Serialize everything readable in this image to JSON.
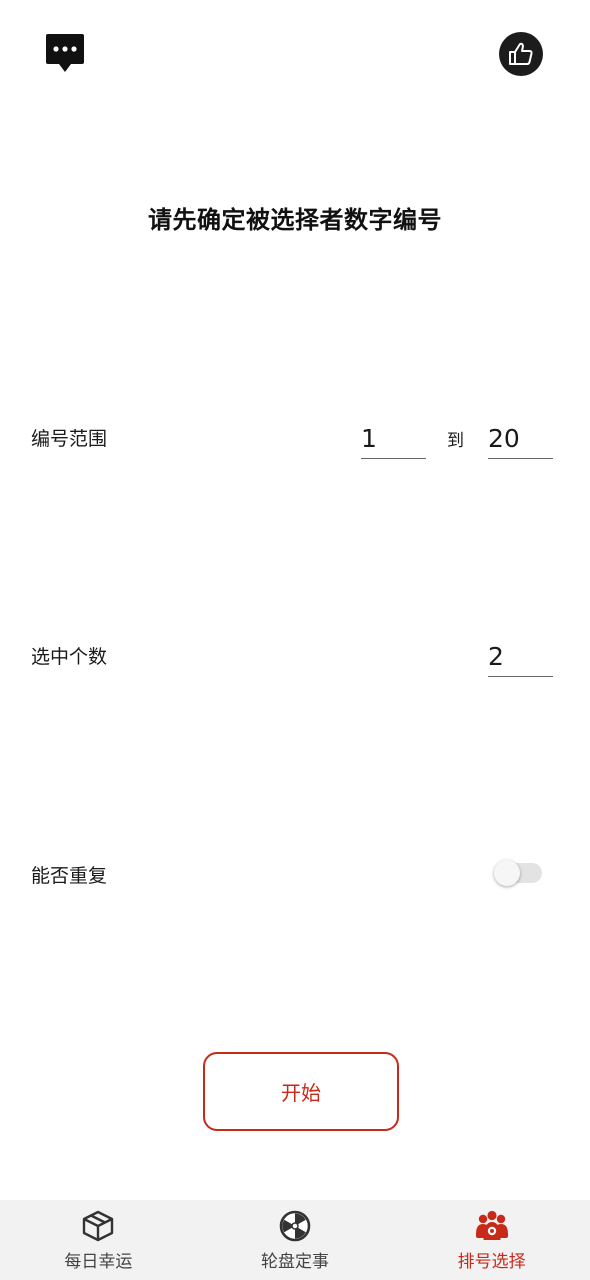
{
  "title": "请先确定被选择者数字编号",
  "range": {
    "label": "编号范围",
    "from_value": "1",
    "to_label": "到",
    "to_value": "20"
  },
  "count": {
    "label": "选中个数",
    "value": "2"
  },
  "repeat": {
    "label": "能否重复",
    "enabled": false
  },
  "start_label": "开始",
  "nav": {
    "items": [
      {
        "label": "每日幸运",
        "icon": "box-icon"
      },
      {
        "label": "轮盘定事",
        "icon": "wheel-icon"
      },
      {
        "label": "排号选择",
        "icon": "people-icon"
      }
    ],
    "active_index": 2
  },
  "colors": {
    "accent": "#c82a1a",
    "icon_dark": "#1c1c1c",
    "nav_background": "#f3f2f2"
  }
}
